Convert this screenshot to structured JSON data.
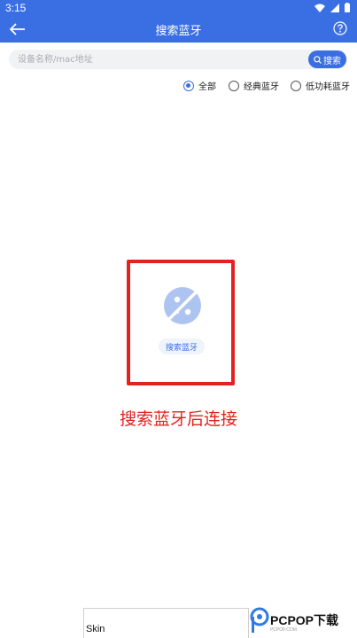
{
  "status_bar": {
    "time": "3:15"
  },
  "app_bar": {
    "title": "搜索蓝牙"
  },
  "search": {
    "placeholder": "设备名称/mac地址",
    "button_label": "搜索"
  },
  "filters": [
    {
      "label": "全部",
      "checked": true
    },
    {
      "label": "经典蓝牙",
      "checked": false
    },
    {
      "label": "低功耗蓝牙",
      "checked": false
    }
  ],
  "empty_state": {
    "button_label": "搜索蓝牙"
  },
  "hint": "搜索蓝牙后连接",
  "footer": {
    "skin_label": "Skin"
  },
  "watermark": {
    "text": "PCPOP下载",
    "sub": "PCPOP.COM"
  },
  "colors": {
    "primary": "#3a6fe4",
    "annotation_red": "#e02320",
    "search_bg": "#f1f2f4"
  }
}
